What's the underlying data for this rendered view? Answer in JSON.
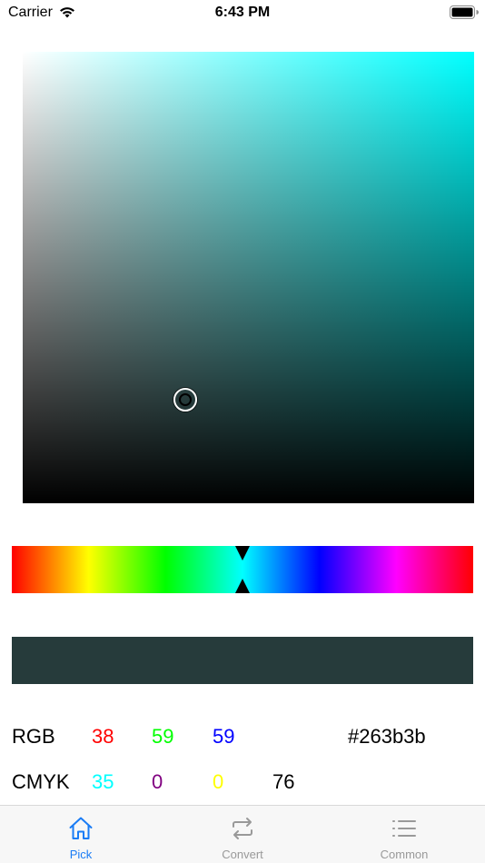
{
  "status_bar": {
    "carrier": "Carrier",
    "time": "6:43 PM"
  },
  "picker": {
    "hue_color": "#00ffff",
    "hue_fraction": 0.5,
    "saturation": 0.36,
    "brightness": 0.23,
    "selected_color": "#263b3b"
  },
  "values": {
    "rgb": {
      "label": "RGB",
      "r": "38",
      "g": "59",
      "b": "59",
      "hex": "#263b3b"
    },
    "cmyk": {
      "label": "CMYK",
      "c": "35",
      "m": "0",
      "y": "0",
      "k": "76"
    },
    "colors": {
      "r": "#ff0000",
      "g": "#00ff00",
      "b": "#0000ff",
      "c": "#00ffff",
      "m": "#800080",
      "y": "#ffff00",
      "k": "#000000"
    }
  },
  "tabs": [
    {
      "label": "Pick",
      "icon": "home-icon",
      "active": true
    },
    {
      "label": "Convert",
      "icon": "repeat-icon",
      "active": false
    },
    {
      "label": "Common",
      "icon": "list-icon",
      "active": false
    }
  ],
  "accent": "#1a7cf5",
  "inactive": "#999999"
}
